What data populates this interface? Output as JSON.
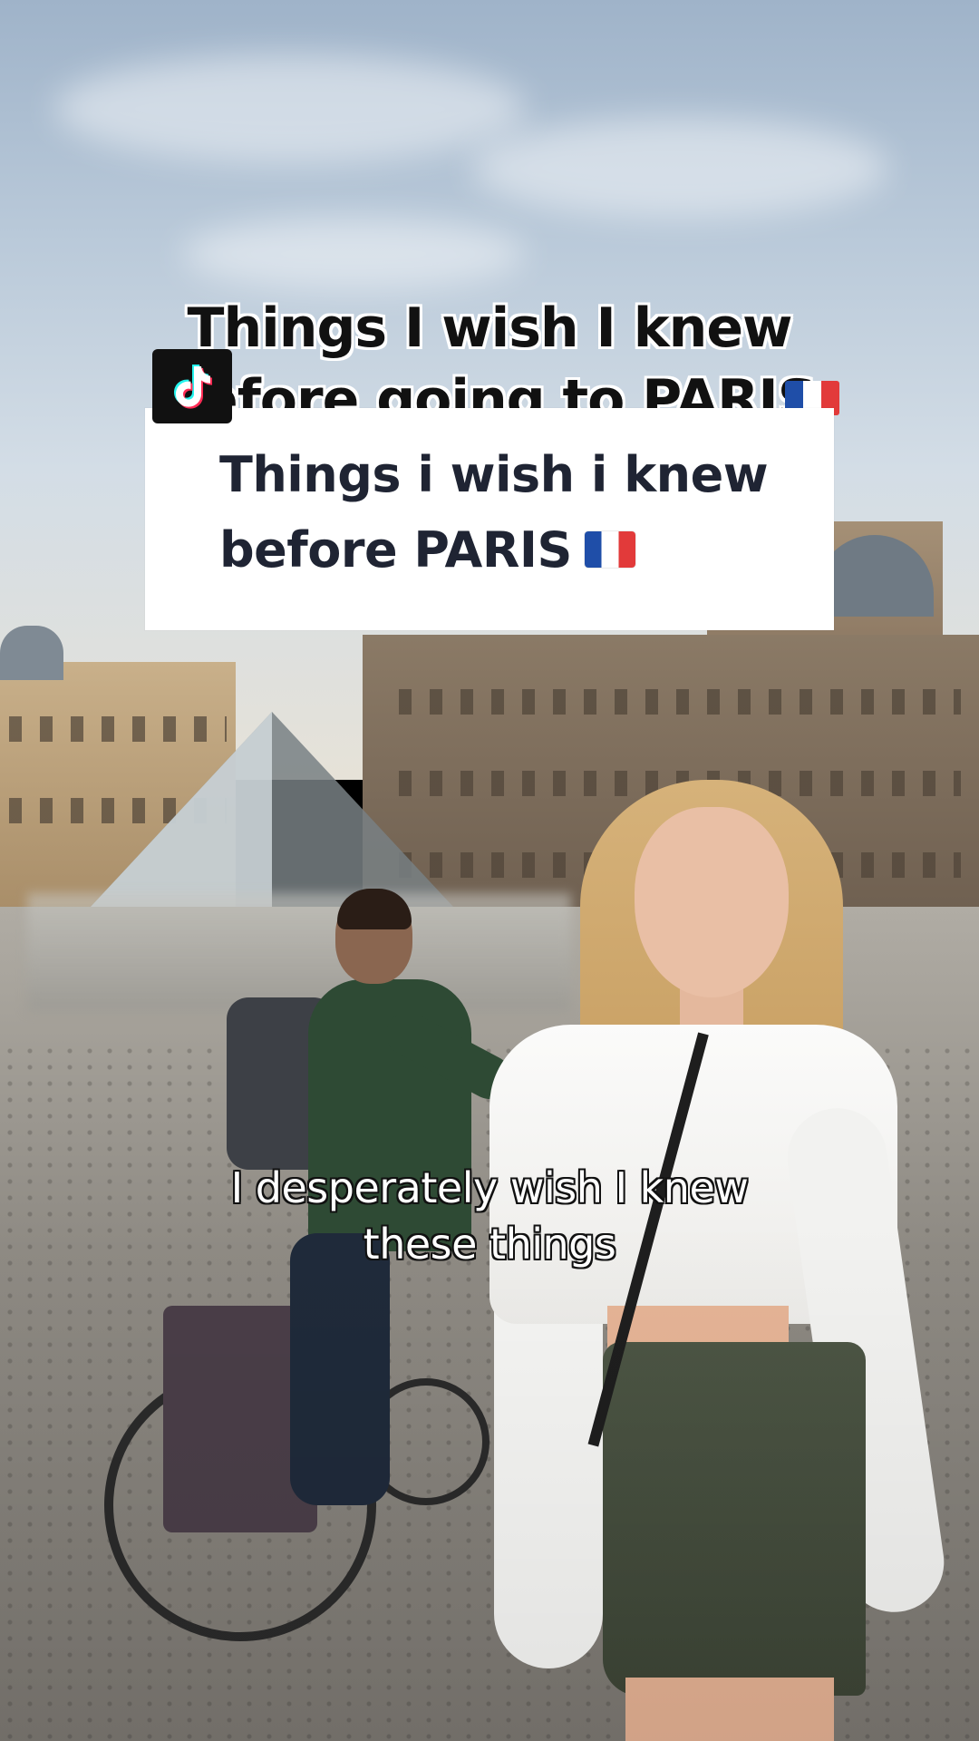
{
  "video": {
    "burned_title_line1": "Things I wish I knew",
    "burned_title_line2": "before going to PARIS",
    "text_card": {
      "line1": "Things i wish i knew",
      "line2": "before PARIS"
    },
    "subtitle_line1": "I desperately wish I knew",
    "subtitle_line2": "these things"
  },
  "icons": {
    "logo": "tiktok-logo-icon",
    "flag": "france-flag-icon"
  },
  "colors": {
    "card_text": "#1f2433",
    "card_bg": "#ffffff",
    "flag_blue": "#1f4ea8",
    "flag_red": "#e23a3a"
  }
}
